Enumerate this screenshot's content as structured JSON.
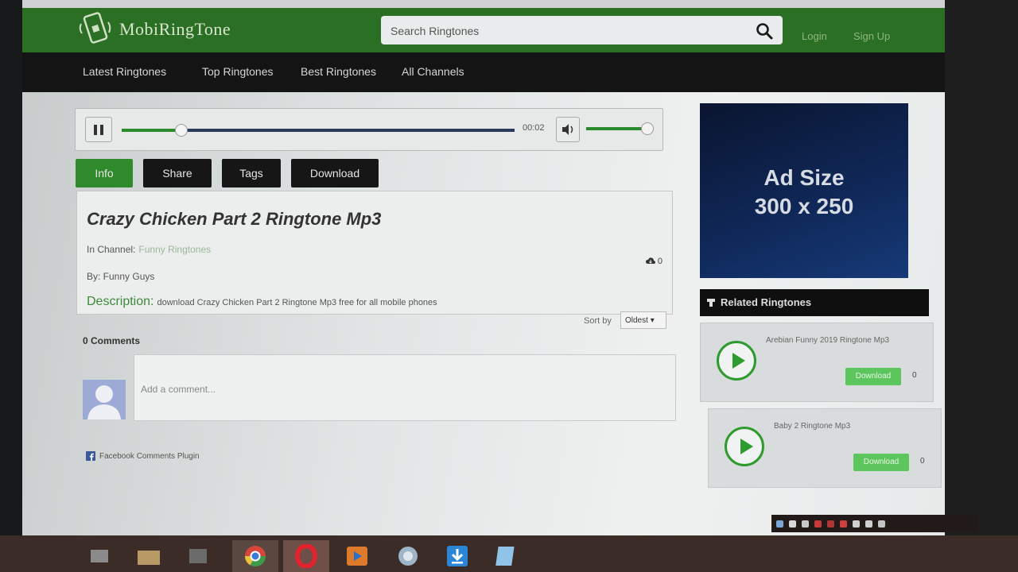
{
  "site": {
    "logo_text": "MobiRingTone",
    "search_placeholder": "Search Ringtones",
    "login": "Login",
    "signup": "Sign Up"
  },
  "nav": {
    "items": [
      {
        "label": "Latest Ringtones"
      },
      {
        "label": "Top Ringtones"
      },
      {
        "label": "Best Ringtones"
      },
      {
        "label": "All Channels"
      }
    ]
  },
  "player": {
    "time": "00:02",
    "progress_fraction": 0.15,
    "volume_fraction": 0.95
  },
  "tabs": [
    {
      "label": "Info",
      "active": true
    },
    {
      "label": "Share",
      "active": false
    },
    {
      "label": "Tags",
      "active": false
    },
    {
      "label": "Download",
      "active": false
    }
  ],
  "info": {
    "title": "Crazy Chicken Part 2 Ringtone Mp3",
    "channel_label": "In Channel:",
    "channel_value": "Funny Ringtones",
    "by_label": "By: Funny Guys",
    "description_label": "Description:",
    "description_text": "download Crazy Chicken Part 2 Ringtone Mp3 free for all mobile phones",
    "download_count": "0"
  },
  "comments": {
    "count_label": "0 Comments",
    "sort_label": "Sort by",
    "sort_value": "Oldest",
    "input_placeholder": "Add a comment...",
    "plugin_label": "Facebook Comments Plugin"
  },
  "ad": {
    "line1": "Ad Size",
    "line2": "300 x 250"
  },
  "related": {
    "header": "Related Ringtones",
    "items": [
      {
        "title": "Arebian Funny 2019 Ringtone Mp3",
        "download_label": "Download",
        "count": "0"
      },
      {
        "title": "Baby 2 Ringtone Mp3",
        "download_label": "Download",
        "count": "0"
      }
    ]
  },
  "colors": {
    "header_green": "#2b6f24",
    "accent_green": "#2d9b2d",
    "nav_black": "#141414"
  },
  "taskbar": {
    "icons": [
      "start-icon",
      "file-explorer-icon",
      "media-icon",
      "chrome-icon",
      "opera-icon",
      "video-player-icon",
      "network-icon",
      "download-icon",
      "notepad-icon"
    ]
  }
}
